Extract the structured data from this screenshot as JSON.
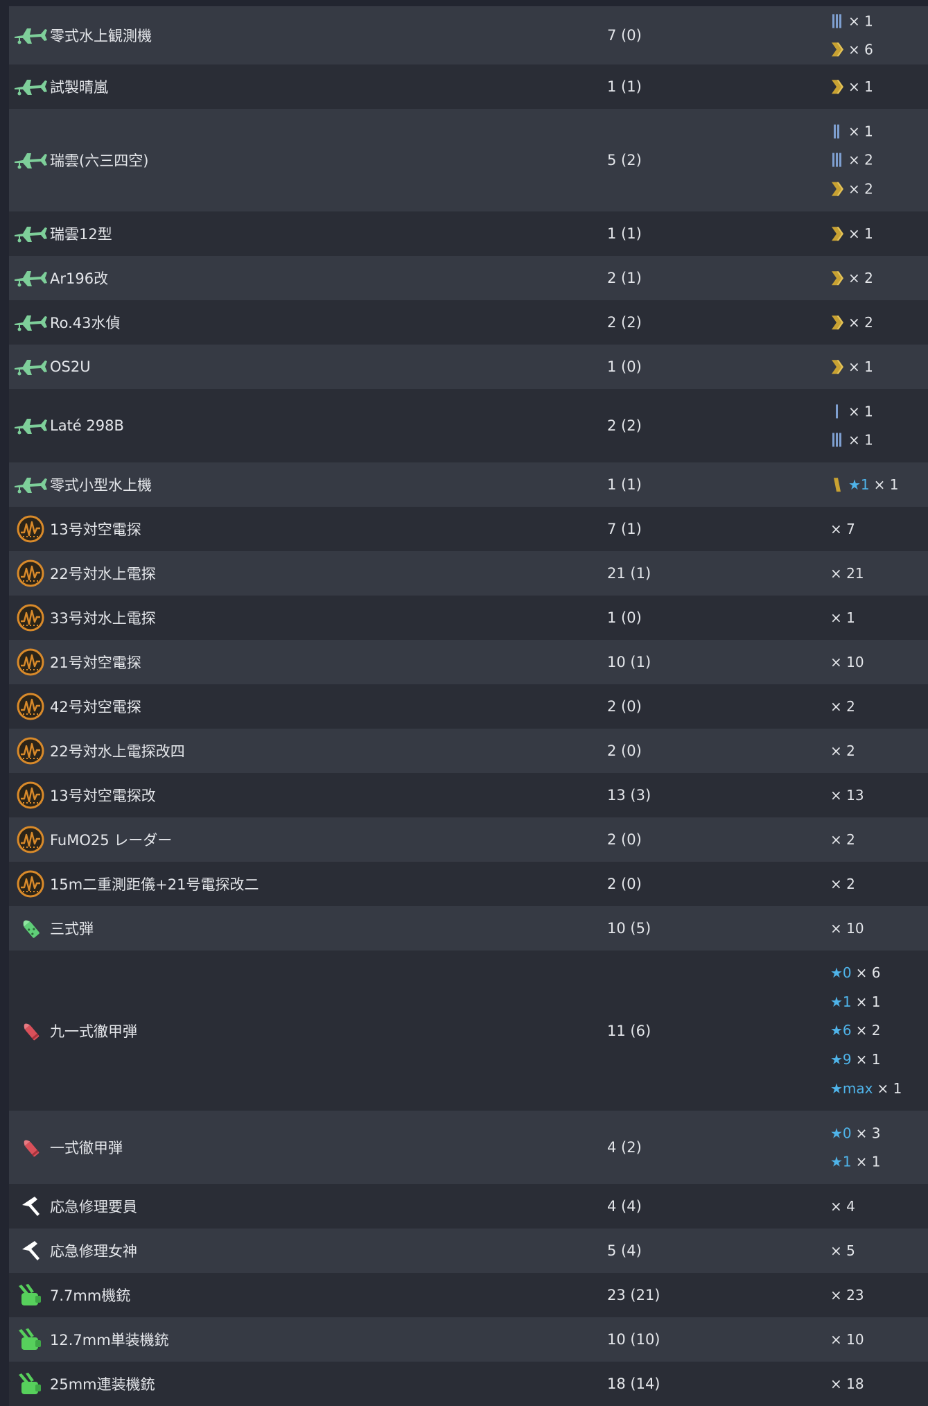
{
  "colors": {
    "row_odd": "#363a44",
    "row_even": "#2a2d36",
    "seaplane_green": "#7ecf9a",
    "radar_orange": "#d98a2a",
    "prof_blue": "#7e9fd0",
    "prof_gold": "#c9a232",
    "star_blue": "#4fb4ea",
    "aa_shell_green": "#5fcf78",
    "ap_shell_red": "#d9505a",
    "aa_gun_green": "#57d05c"
  },
  "rows": [
    {
      "icon": "seaplane-icon",
      "name": "零式水上観測機",
      "count": "7 (0)",
      "improvements": [
        {
          "prof": "prof-3-icon",
          "text": "× 1"
        },
        {
          "prof": "prof-gold-icon",
          "text": "× 6"
        }
      ]
    },
    {
      "icon": "seaplane-icon",
      "name": "試製晴嵐",
      "count": "1 (1)",
      "improvements": [
        {
          "prof": "prof-gold-icon",
          "text": "× 1"
        }
      ]
    },
    {
      "icon": "seaplane-icon",
      "name": "瑞雲(六三四空)",
      "count": "5 (2)",
      "improvements": [
        {
          "prof": "prof-2-icon",
          "text": "× 1"
        },
        {
          "prof": "prof-3-icon",
          "text": "× 2"
        },
        {
          "prof": "prof-gold-icon",
          "text": "× 2"
        }
      ]
    },
    {
      "icon": "seaplane-icon",
      "name": "瑞雲12型",
      "count": "1 (1)",
      "improvements": [
        {
          "prof": "prof-gold-icon",
          "text": "× 1"
        }
      ]
    },
    {
      "icon": "seaplane-icon",
      "name": "Ar196改",
      "count": "2 (1)",
      "improvements": [
        {
          "prof": "prof-gold-icon",
          "text": "× 2"
        }
      ]
    },
    {
      "icon": "seaplane-icon",
      "name": "Ro.43水偵",
      "count": "2 (2)",
      "improvements": [
        {
          "prof": "prof-gold-icon",
          "text": "× 2"
        }
      ]
    },
    {
      "icon": "seaplane-icon",
      "name": "OS2U",
      "count": "1 (0)",
      "improvements": [
        {
          "prof": "prof-gold-icon",
          "text": "× 1"
        }
      ]
    },
    {
      "icon": "seaplane-icon",
      "name": "Laté 298B",
      "count": "2 (2)",
      "improvements": [
        {
          "prof": "prof-1-icon",
          "text": "× 1"
        },
        {
          "prof": "prof-3-icon",
          "text": "× 1"
        }
      ]
    },
    {
      "icon": "seaplane-icon",
      "name": "零式小型水上機",
      "count": "1 (1)",
      "improvements": [
        {
          "prof": "prof-gold-single-icon",
          "star": "★1",
          "text": "× 1"
        }
      ]
    },
    {
      "icon": "radar-icon",
      "name": "13号対空電探",
      "count": "7 (1)",
      "improvements": [
        {
          "text": "× 7"
        }
      ]
    },
    {
      "icon": "radar-icon",
      "name": "22号対水上電探",
      "count": "21 (1)",
      "improvements": [
        {
          "text": "× 21"
        }
      ]
    },
    {
      "icon": "radar-icon",
      "name": "33号対水上電探",
      "count": "1 (0)",
      "improvements": [
        {
          "text": "× 1"
        }
      ]
    },
    {
      "icon": "radar-icon",
      "name": "21号対空電探",
      "count": "10 (1)",
      "improvements": [
        {
          "text": "× 10"
        }
      ]
    },
    {
      "icon": "radar-icon",
      "name": "42号対空電探",
      "count": "2 (0)",
      "improvements": [
        {
          "text": "× 2"
        }
      ]
    },
    {
      "icon": "radar-icon",
      "name": "22号対水上電探改四",
      "count": "2 (0)",
      "improvements": [
        {
          "text": "× 2"
        }
      ]
    },
    {
      "icon": "radar-icon",
      "name": "13号対空電探改",
      "count": "13 (3)",
      "improvements": [
        {
          "text": "× 13"
        }
      ]
    },
    {
      "icon": "radar-icon",
      "name": "FuMO25 レーダー",
      "count": "2 (0)",
      "improvements": [
        {
          "text": "× 2"
        }
      ]
    },
    {
      "icon": "radar-icon",
      "name": "15m二重測距儀+21号電探改二",
      "count": "2 (0)",
      "improvements": [
        {
          "text": "× 2"
        }
      ]
    },
    {
      "icon": "aa-shell-icon",
      "name": "三式弾",
      "count": "10 (5)",
      "improvements": [
        {
          "text": "× 10"
        }
      ]
    },
    {
      "icon": "ap-shell-icon",
      "name": "九一式徹甲弾",
      "count": "11 (6)",
      "improvements": [
        {
          "star": "★0",
          "text": "× 6"
        },
        {
          "star": "★1",
          "text": "× 1"
        },
        {
          "star": "★6",
          "text": "× 2"
        },
        {
          "star": "★9",
          "text": "× 1"
        },
        {
          "star": "★max",
          "text": "× 1"
        }
      ]
    },
    {
      "icon": "ap-shell-icon",
      "name": "一式徹甲弾",
      "count": "4 (2)",
      "improvements": [
        {
          "star": "★0",
          "text": "× 3"
        },
        {
          "star": "★1",
          "text": "× 1"
        }
      ]
    },
    {
      "icon": "repair-icon",
      "name": "応急修理要員",
      "count": "4 (4)",
      "improvements": [
        {
          "text": "× 4"
        }
      ]
    },
    {
      "icon": "repair-icon",
      "name": "応急修理女神",
      "count": "5 (4)",
      "improvements": [
        {
          "text": "× 5"
        }
      ]
    },
    {
      "icon": "aa-gun-icon",
      "name": "7.7mm機銃",
      "count": "23 (21)",
      "improvements": [
        {
          "text": "× 23"
        }
      ]
    },
    {
      "icon": "aa-gun-icon",
      "name": "12.7mm単装機銃",
      "count": "10 (10)",
      "improvements": [
        {
          "text": "× 10"
        }
      ]
    },
    {
      "icon": "aa-gun-icon",
      "name": "25mm連装機銃",
      "count": "18 (14)",
      "improvements": [
        {
          "text": "× 18"
        }
      ]
    }
  ]
}
